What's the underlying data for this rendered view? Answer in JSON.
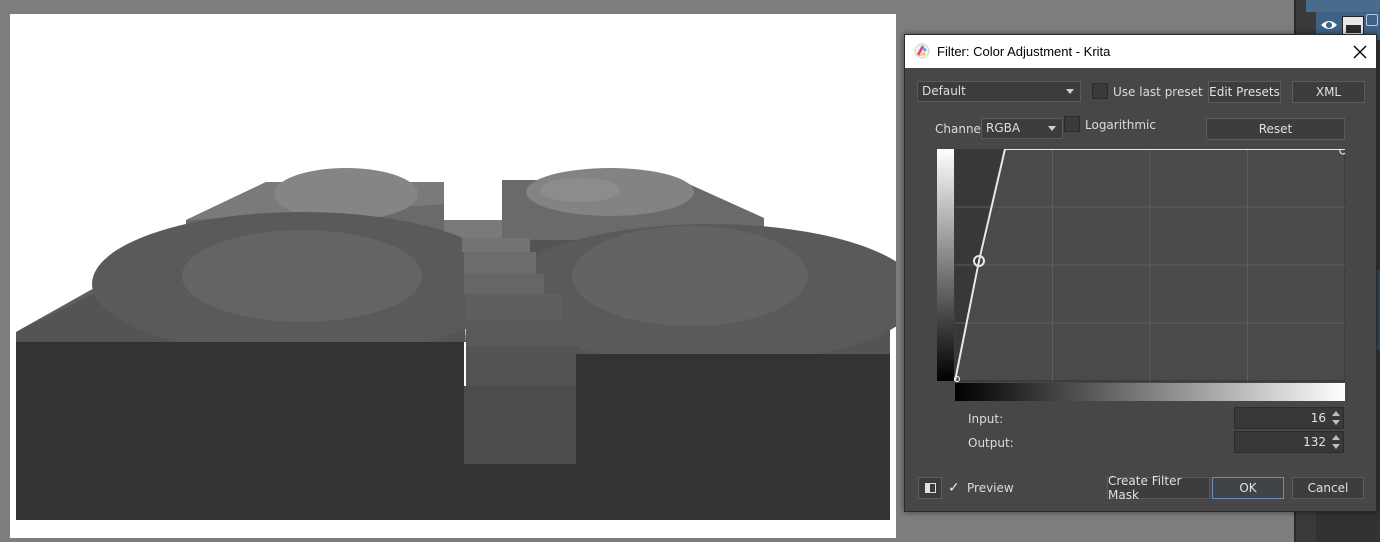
{
  "colors": {
    "workspace_bg": "#7e7e7e",
    "dialog_bg": "#474747",
    "accent_blue": "#3f6286"
  },
  "dialog": {
    "title": "Filter: Color Adjustment - Krita",
    "icons": {
      "app": "krita-logo-icon",
      "close": "close-icon"
    },
    "preset_combo": {
      "value": "Default"
    },
    "use_last_preset": {
      "label": "Use last preset",
      "checked": false
    },
    "edit_presets_label": "Edit Presets",
    "xml_label": "XML",
    "channel": {
      "label": "Channel:",
      "value": "RGBA"
    },
    "logarithmic": {
      "label": "Logarithmic",
      "checked": false
    },
    "reset_label": "Reset",
    "input": {
      "label": "Input:",
      "value": "16"
    },
    "output": {
      "label": "Output:",
      "value": "132"
    },
    "preview": {
      "label": "Preview",
      "checked": true
    },
    "create_filter_mask_label": "Create Filter Mask",
    "ok_label": "OK",
    "cancel_label": "Cancel"
  },
  "docker": {
    "icons": {
      "visibility": "eye-icon",
      "layer_thumbnail": "layer-thumbnail"
    }
  }
}
